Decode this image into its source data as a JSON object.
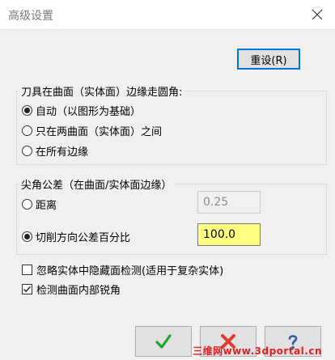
{
  "window": {
    "title": "高级设置",
    "close_icon": "close-icon"
  },
  "reset_button": {
    "label": "重设(R)"
  },
  "rounding_group": {
    "title": "刀具在曲面（实体面）边缘走圆角:",
    "options": [
      {
        "label": "自动（以图形为基础）",
        "selected": true
      },
      {
        "label": "只在两曲面（实体面）之间",
        "selected": false
      },
      {
        "label": "在所有边缘",
        "selected": false
      }
    ]
  },
  "tolerance_group": {
    "title": "尖角公差（在曲面/实体面边缘）",
    "distance": {
      "label": "距离",
      "selected": false,
      "value": "0.25"
    },
    "percent": {
      "label": "切削方向公差百分比",
      "selected": true,
      "value": "100.0"
    }
  },
  "checks": [
    {
      "label": "忽略实体中隐藏面检测(适用于复杂实体)",
      "checked": false
    },
    {
      "label": "检测曲面内部锐角",
      "checked": true
    }
  ],
  "footer_buttons": [
    {
      "icon": "checkmark-icon",
      "color": "#21a136"
    },
    {
      "icon": "x-cross-icon",
      "color": "#e23a2f"
    },
    {
      "icon": "help-icon",
      "color": "#2f5aa8"
    }
  ],
  "watermark": "三维网www.3dportal.cn"
}
